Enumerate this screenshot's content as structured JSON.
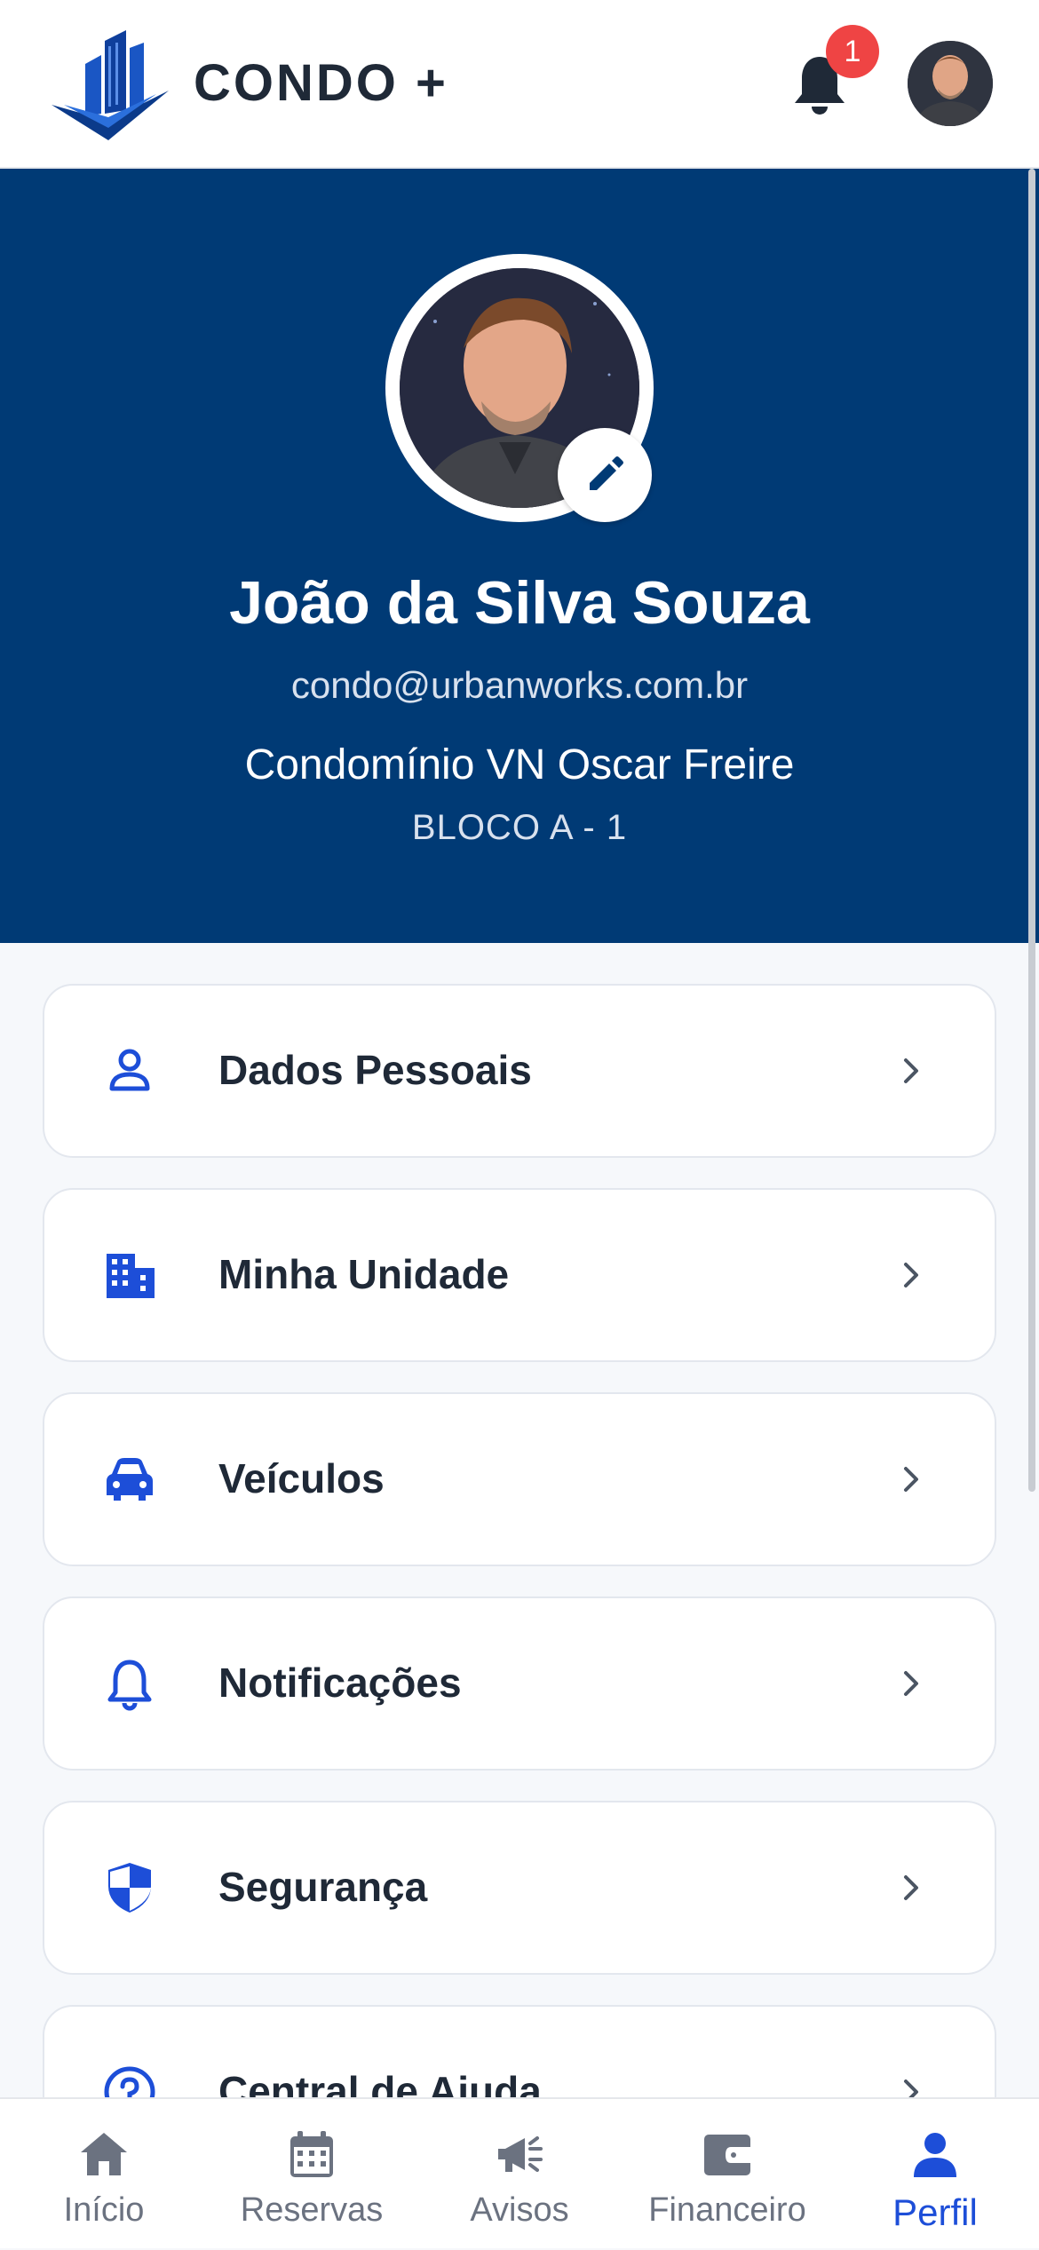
{
  "app": {
    "brand": "CONDO +"
  },
  "header": {
    "notification_count": "1"
  },
  "profile": {
    "name": "João da Silva Souza",
    "email": "condo@urbanworks.com.br",
    "condominium": "Condomínio VN Oscar Freire",
    "unit": "BLOCO A - 1"
  },
  "menu": {
    "items": [
      {
        "label": "Dados Pessoais",
        "icon": "person-icon"
      },
      {
        "label": "Minha Unidade",
        "icon": "building-icon"
      },
      {
        "label": "Veículos",
        "icon": "car-icon"
      },
      {
        "label": "Notificações",
        "icon": "bell-icon"
      },
      {
        "label": "Segurança",
        "icon": "shield-icon"
      },
      {
        "label": "Central de Ajuda",
        "icon": "help-icon"
      }
    ]
  },
  "nav": {
    "items": [
      {
        "label": "Início",
        "icon": "home-icon"
      },
      {
        "label": "Reservas",
        "icon": "calendar-icon"
      },
      {
        "label": "Avisos",
        "icon": "megaphone-icon"
      },
      {
        "label": "Financeiro",
        "icon": "wallet-icon"
      },
      {
        "label": "Perfil",
        "icon": "user-icon",
        "active": true
      }
    ]
  },
  "colors": {
    "primary_dark": "#003a75",
    "accent_blue": "#1d4ed8",
    "badge_red": "#ef4444",
    "nav_inactive": "#6b7280"
  }
}
